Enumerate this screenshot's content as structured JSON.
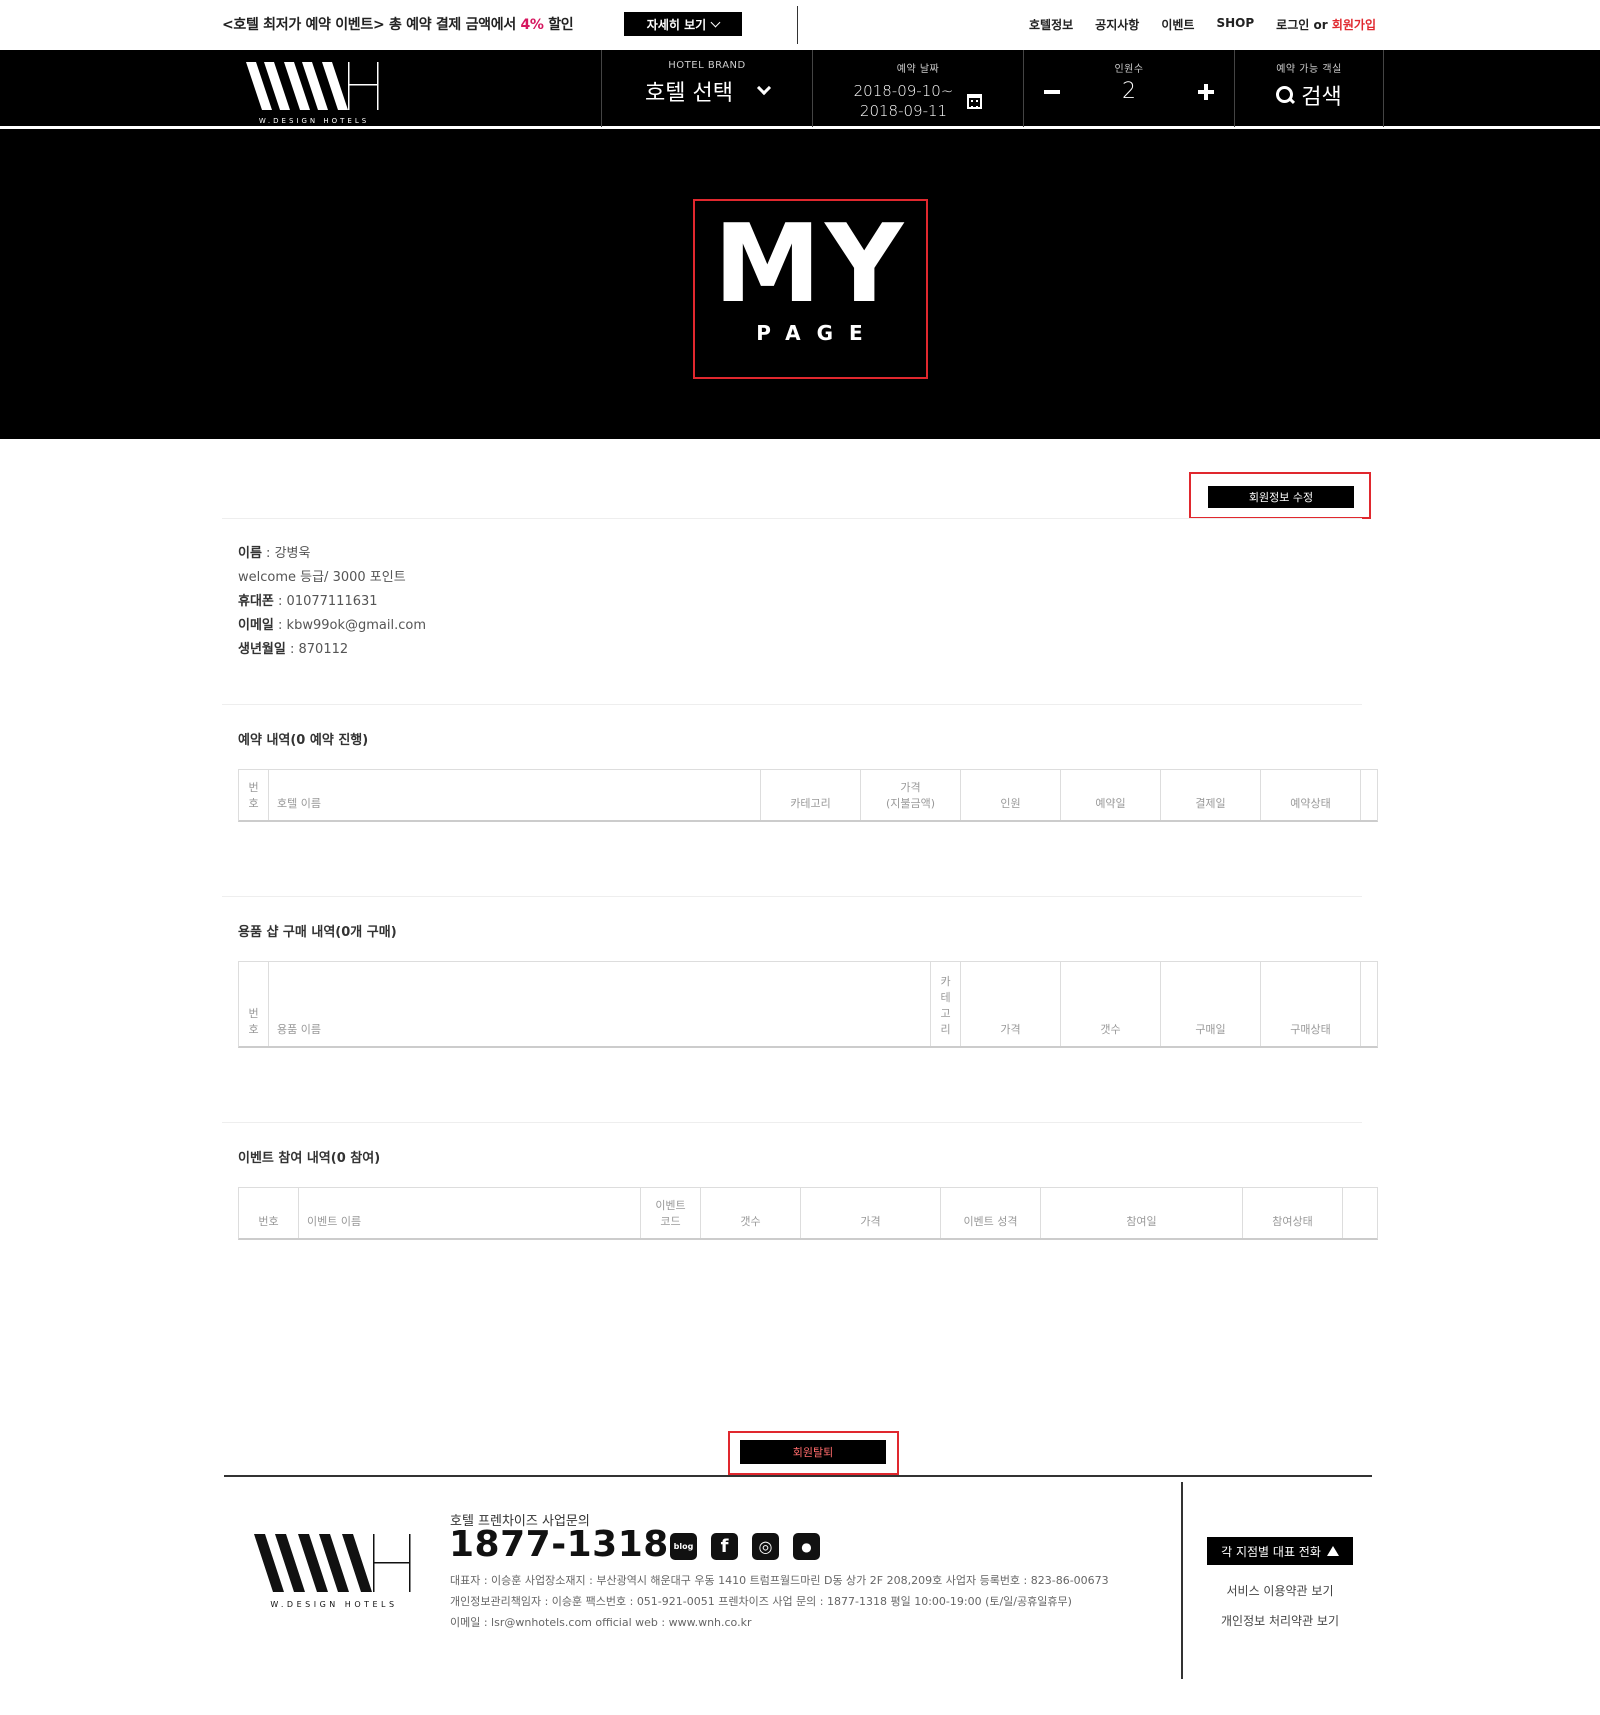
{
  "topbar": {
    "promo_text": "<호텔 최저가 예약 이벤트> 총 예약 결제 금액에서 ",
    "promo_pct": "4%",
    "promo_suffix": " 할인",
    "details_button": "자세히 보기",
    "nav": {
      "hotel_info": "호텔정보",
      "notice": "공지사항",
      "event": "이벤트",
      "shop": "SHOP",
      "login": "로그인",
      "or": "or",
      "join": "회원가입"
    }
  },
  "header": {
    "logo_subtext": "W.DESIGN HOTELS",
    "brand_label": "HOTEL BRAND",
    "brand_value": "호텔 선택",
    "date_label": "예약 날짜",
    "date_from": "2018-09-10~",
    "date_to": "2018-09-11",
    "people_label": "인원수",
    "people_value": "2",
    "search_label": "예약 가능 객실",
    "search_value": "검색"
  },
  "hero": {
    "title": "MY",
    "subtitle": "PAGE"
  },
  "member": {
    "edit_button": "회원정보 수정",
    "name_key": "이름",
    "name_value": "강병욱",
    "grade_line": "welcome 등급/ 3000 포인트",
    "phone_key": "휴대폰",
    "phone_value": "01077111631",
    "email_key": "이메일",
    "email_value": "kbw99ok@gmail.com",
    "birth_key": "생년월일",
    "birth_value": "870112"
  },
  "reservations": {
    "title": "예약 내역(0 예약 진행)",
    "headers": [
      "번\n호",
      "호텔 이름",
      "카테고리",
      "가격\n(지불금액)",
      "인원",
      "예약일",
      "결제일",
      "예약상태",
      ""
    ]
  },
  "shop": {
    "title": "용품 샵 구매 내역(0개 구매)",
    "headers": [
      "번\n호",
      "용품 이름",
      "카\n테\n고\n리",
      "가격",
      "갯수",
      "구매일",
      "구매상태",
      ""
    ]
  },
  "events": {
    "title": "이벤트 참여 내역(0 참여)",
    "headers": [
      "번호",
      "이벤트 이름",
      "이벤트\n코드",
      "갯수",
      "가격",
      "이벤트 성격",
      "참여일",
      "참여상태",
      ""
    ]
  },
  "withdraw_button": "회원탈퇴",
  "footer": {
    "logo_subtext": "W.DESIGN HOTELS",
    "inquiry_label": "호텔 프렌차이즈 사업문의",
    "phone": "1877-1318",
    "sns": [
      {
        "icon": "blog-icon",
        "text": "blog"
      },
      {
        "icon": "facebook-icon",
        "text": "f"
      },
      {
        "icon": "instagram-icon",
        "text": "◎"
      },
      {
        "icon": "map-pin-icon",
        "text": "●"
      }
    ],
    "info_line1": "대표자 : 이승훈   사업장소재지 : 부산광역시 해운대구 우동 1410 트럼프월드마린 D동 상가 2F 208,209호   사업자 등록번호 : 823-86-00673",
    "info_line2": "개인정보관리책임자 : 이승훈   팩스번호 : 051-921-0051   프렌차이즈 사업 문의 : 1877-1318   평일 10:00-19:00 (토/일/공휴일휴무)",
    "info_line3": "이메일 : lsr@wnhotels.com   official web : www.wnh.co.kr",
    "branch_button": "각 지점별 대표 전화",
    "terms_link": "서비스 이용약관 보기",
    "privacy_link": "개인정보 처리약관 보기"
  }
}
